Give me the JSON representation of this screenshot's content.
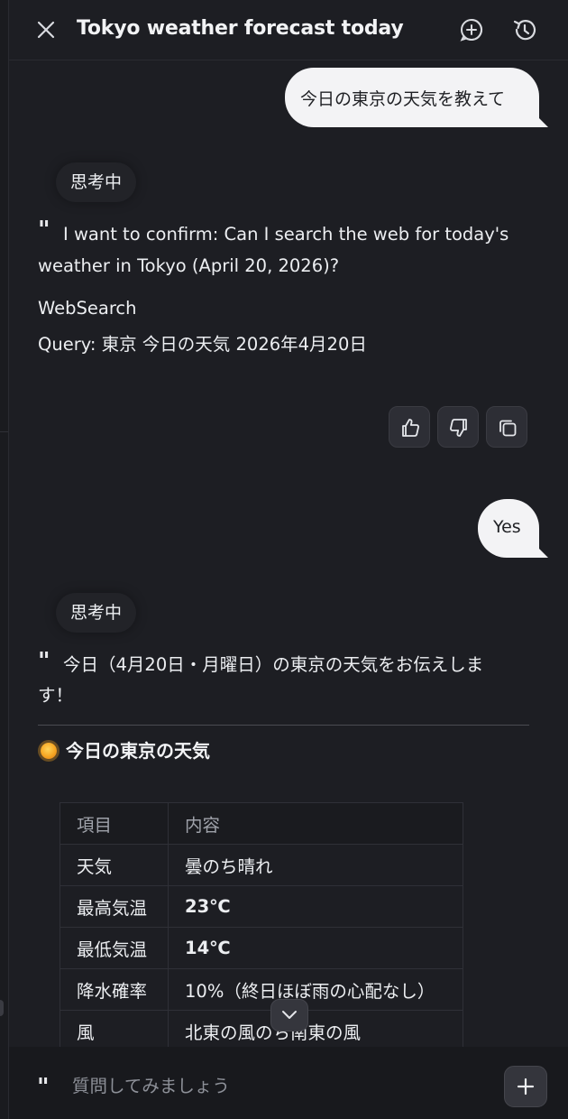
{
  "header": {
    "title": "Tokyo weather forecast today",
    "close_icon": "close-icon",
    "new_chat_icon": "new-chat-icon",
    "history_icon": "history-icon"
  },
  "messages": {
    "user1": "今日の東京の天気を教えて",
    "thinking1": "思考中",
    "assistant1_line1": "I want to confirm: Can I search the web for today's",
    "assistant1_line2": "weather in Tokyo (April 20, 2026)?",
    "tool_name": "WebSearch",
    "tool_query": "Query: 東京 今日の天気 2026年4月20日",
    "user2": "Yes",
    "thinking2": "思考中",
    "assistant2_line1": "今日（4月20日・月曜日）の東京の天気をお伝えしま",
    "assistant2_line2": "す！",
    "section_title": "今日の東京の天気"
  },
  "actions": [
    "thumbs-up-icon",
    "thumbs-down-icon",
    "copy-icon"
  ],
  "table": {
    "headers": [
      "項目",
      "内容"
    ],
    "rows": [
      [
        "天気",
        "曇のち晴れ"
      ],
      [
        "最高気温",
        "23℃"
      ],
      [
        "最低気温",
        "14℃"
      ],
      [
        "降水確率",
        "10%（終日ほぼ雨の心配なし）"
      ],
      [
        "風",
        "北東の風のち南東の風"
      ]
    ]
  },
  "composer": {
    "placeholder": "質問してみましょう",
    "quote_mark": "\"",
    "plus_icon": "plus-icon"
  },
  "colors": {
    "background": "#1d1e23",
    "user_bubble": "#f3f3f5",
    "composer_bg": "#18191d"
  }
}
